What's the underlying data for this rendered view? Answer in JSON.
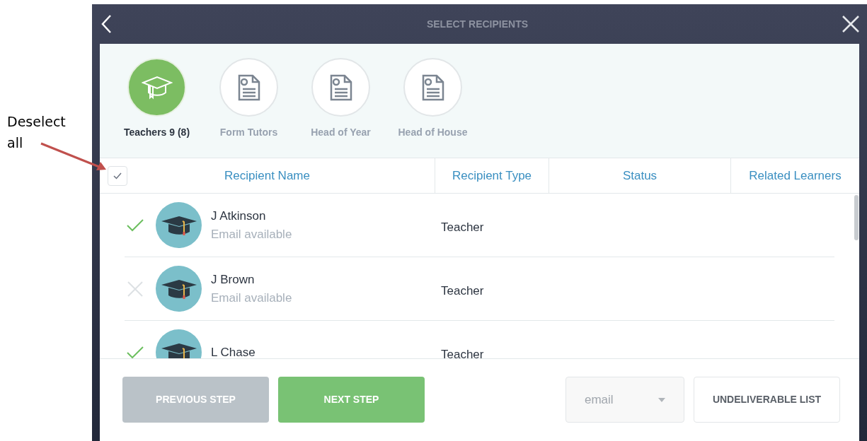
{
  "annotation": {
    "text": "Deselect all"
  },
  "header": {
    "title": "SELECT RECIPIENTS"
  },
  "groups": [
    {
      "label": "Teachers 9 (8)",
      "kind": "cap",
      "selected": true
    },
    {
      "label": "Form Tutors",
      "kind": "document",
      "selected": false
    },
    {
      "label": "Head of Year",
      "kind": "document",
      "selected": false
    },
    {
      "label": "Head of House",
      "kind": "document",
      "selected": false
    }
  ],
  "select_all": {
    "checked": true
  },
  "columns": [
    "Recipient Name",
    "Recipient Type",
    "Status",
    "Related Learners"
  ],
  "rows": [
    {
      "name": "J Atkinson",
      "subtitle": "Email available",
      "type": "Teacher",
      "selected": true
    },
    {
      "name": "J Brown",
      "subtitle": "Email available",
      "type": "Teacher",
      "selected": false
    },
    {
      "name": "L Chase",
      "type": "Teacher",
      "selected": true
    }
  ],
  "footer": {
    "previous": "PREVIOUS STEP",
    "next": "NEXT STEP",
    "channel": "email",
    "undeliverable": "UNDELIVERABLE LIST"
  }
}
